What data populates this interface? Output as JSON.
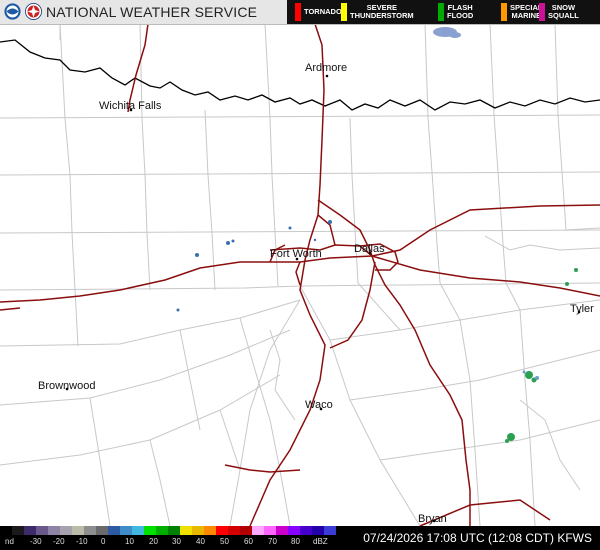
{
  "header": {
    "title": "NATIONAL WEATHER SERVICE",
    "background": "#e6e6e6"
  },
  "legend": [
    {
      "label": "TORNADO",
      "color": "#ff0000"
    },
    {
      "label": "SEVERE\nTHUNDERSTORM",
      "color": "#ffff00"
    },
    {
      "label": "FLASH\nFLOOD",
      "color": "#00aa00"
    },
    {
      "label": "SPECIAL\nMARINE",
      "color": "#ff9900"
    },
    {
      "label": "SNOW\nSQUALL",
      "color": "#cc1199"
    }
  ],
  "cities": [
    {
      "name": "Ardmore"
    },
    {
      "name": "Wichita Falls"
    },
    {
      "name": "Fort Worth"
    },
    {
      "name": "Dallas"
    },
    {
      "name": "Tyler"
    },
    {
      "name": "Brownwood"
    },
    {
      "name": "Waco"
    },
    {
      "name": "Bryan"
    }
  ],
  "scale": {
    "ticks": [
      "nd",
      "-30",
      "-20",
      "-10",
      "0",
      "10",
      "20",
      "30",
      "40",
      "50",
      "60",
      "70",
      "80",
      "dBZ"
    ],
    "colors": [
      "#000000",
      "#1a1a1a",
      "#3d2b6b",
      "#6a5a8c",
      "#8d84a6",
      "#a6a3ae",
      "#bcbba8",
      "#8e8e8e",
      "#6a6a6a",
      "#2c5ba3",
      "#3e8cc8",
      "#40b8e0",
      "#00e000",
      "#00b000",
      "#008000",
      "#f0e000",
      "#e8b800",
      "#ff8800",
      "#ff0000",
      "#d40000",
      "#b00000",
      "#ffaaff",
      "#ff66ff",
      "#cc00cc",
      "#8800ff",
      "#4400cc",
      "#2200aa",
      "#3b3bd6"
    ]
  },
  "timestamp": "07/24/2026 17:08 UTC (12:08 CDT) KFWS",
  "map_colors": {
    "county_lines": "#c4c4c4",
    "state_line": "#000000",
    "highways": "#8b0e0e"
  }
}
